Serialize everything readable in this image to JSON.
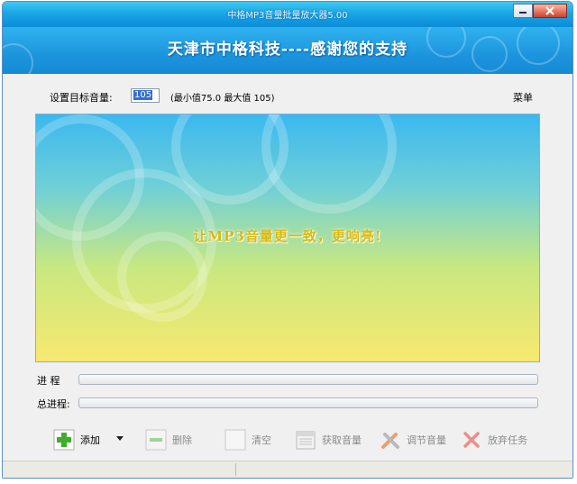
{
  "window": {
    "title": "中格MP3音量批量放大器5.00"
  },
  "banner": {
    "text": "天津市中格科技----感谢您的支持"
  },
  "settings": {
    "target_label": "设置目标音量:",
    "volume_value": "105",
    "range_text": "(最小值75.0   最大值 105)",
    "menu_label": "菜单"
  },
  "canvas": {
    "message": "让MP3音量更一致，更响亮!"
  },
  "progress": {
    "item_label": "进  程",
    "item_progress": 0,
    "total_label": "总进程:",
    "total_progress": 0
  },
  "toolbar": {
    "add": "添加",
    "delete": "删除",
    "clear": "清空",
    "get_volume": "获取音量",
    "adjust_volume": "调节音量",
    "abort": "放弃任务"
  },
  "colors": {
    "title_bar": "#1aa6e6",
    "banner": "#1d95dd",
    "canvas_message": "#d6ba14"
  }
}
